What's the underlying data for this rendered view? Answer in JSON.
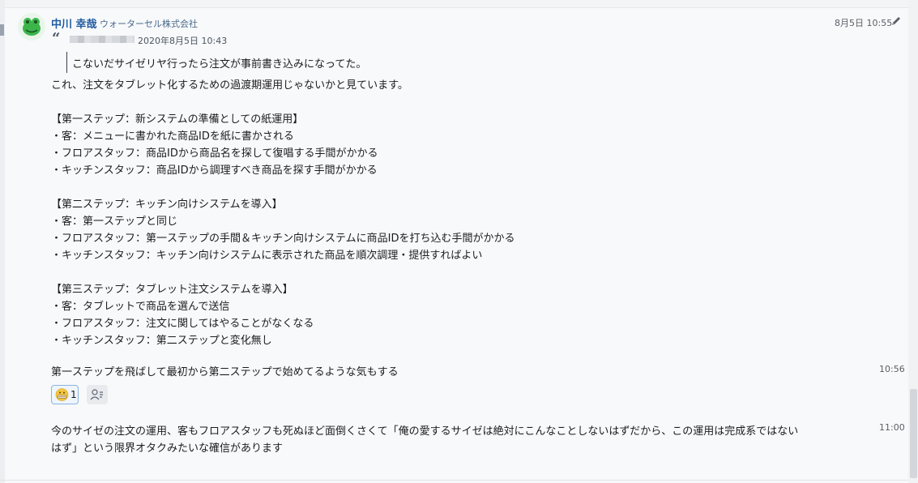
{
  "post": {
    "author": "中川 幸哉",
    "company": "ウォーターセル株式会社",
    "timestamp": "8月5日 10:55",
    "quote": {
      "date": "2020年8月5日 10:43",
      "text": "こないだサイゼリヤ行ったら注文が事前書き込みになってた。"
    },
    "lines": [
      "これ、注文をタブレット化するための過渡期運用じゃないかと見ています。",
      "【第一ステップ：新システムの準備としての紙運用】",
      "・客：メニューに書かれた商品IDを紙に書かされる",
      "・フロアスタッフ：商品IDから商品名を探して復唱する手間がかかる",
      "・キッチンスタッフ：商品IDから調理すべき商品を探す手間がかかる",
      "【第二ステップ：キッチン向けシステムを導入】",
      "・客：第一ステップと同じ",
      "・フロアスタッフ：第一ステップの手間＆キッチン向けシステムに商品IDを打ち込む手間がかかる",
      "・キッチンスタッフ：キッチン向けシステムに表示された商品を順次調理・提供すればよい",
      "【第三ステップ：タブレット注文システムを導入】",
      "・客：タブレットで商品を選んで送信",
      "・フロアスタッフ：注文に関してはやることがなくなる",
      "・キッチンスタッフ：第二ステップと変化無し"
    ]
  },
  "followups": [
    {
      "time": "10:56",
      "text": "第一ステップを飛ばして最初から第二ステップで始めてるような気もする"
    },
    {
      "time": "11:00",
      "text": "今のサイゼの注文の運用、客もフロアスタッフも死ぬほど面倒くさくて「俺の愛するサイゼは絶対にこんなことしないはずだから、この運用は完成系ではない",
      "text_cont": "はず」という限界オタクみたいな確信があります"
    }
  ],
  "reactions": [
    {
      "icon": "grimacing-face-icon",
      "count": "1"
    }
  ],
  "colors": {
    "author": "#1e5aa0",
    "reaction_border": "#8ab4dd",
    "background": "#f8f9fb"
  }
}
